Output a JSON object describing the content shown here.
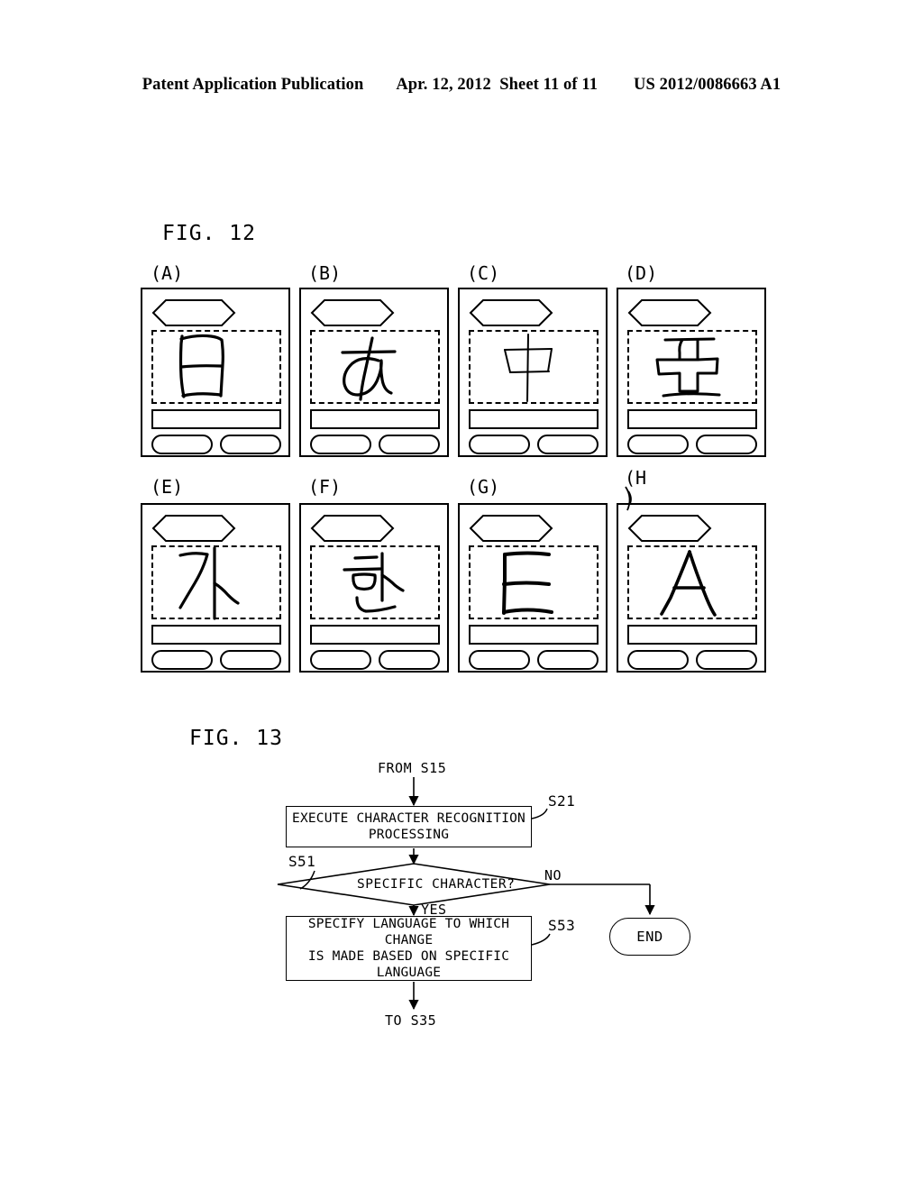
{
  "header": {
    "publication": "Patent Application Publication",
    "date_sheet": "Apr. 12, 2012  Sheet 11 of 11",
    "patent_number": "US 2012/0086663 A1"
  },
  "figures": {
    "fig12": {
      "label": "FIG. 12",
      "panels": [
        {
          "label": "(A)",
          "character": "日",
          "script": "japanese-kanji"
        },
        {
          "label": "(B)",
          "character": "あ",
          "script": "japanese-hiragana"
        },
        {
          "label": "(C)",
          "character": "中",
          "script": "chinese-traditional"
        },
        {
          "label": "(D)",
          "character": "亚",
          "script": "chinese-simplified"
        },
        {
          "label": "(E)",
          "character": "가",
          "script": "korean-hangul"
        },
        {
          "label": "(F)",
          "character": "한",
          "script": "korean-hangul"
        },
        {
          "label": "(G)",
          "character": "E",
          "script": "latin"
        },
        {
          "label": "(H",
          "label_tail": ")",
          "character": "A",
          "script": "latin"
        }
      ]
    },
    "fig13": {
      "label": "FIG. 13",
      "entry_text": "FROM S15",
      "exit_text": "TO S35",
      "nodes": [
        {
          "id": "s21",
          "step": "S21",
          "text": "EXECUTE CHARACTER RECOGNITION\nPROCESSING",
          "shape": "process"
        },
        {
          "id": "s51",
          "step": "S51",
          "text": "SPECIFIC CHARACTER?",
          "shape": "decision"
        },
        {
          "id": "s53",
          "step": "S53",
          "text": "SPECIFY LANGUAGE TO WHICH CHANGE\nIS MADE BASED ON SPECIFIC\nLANGUAGE",
          "shape": "process"
        },
        {
          "id": "end",
          "step": "",
          "text": "END",
          "shape": "terminator"
        }
      ],
      "branch_yes": "YES",
      "branch_no": "NO"
    }
  },
  "colors": {
    "ink": "#000000",
    "paper": "#ffffff"
  }
}
